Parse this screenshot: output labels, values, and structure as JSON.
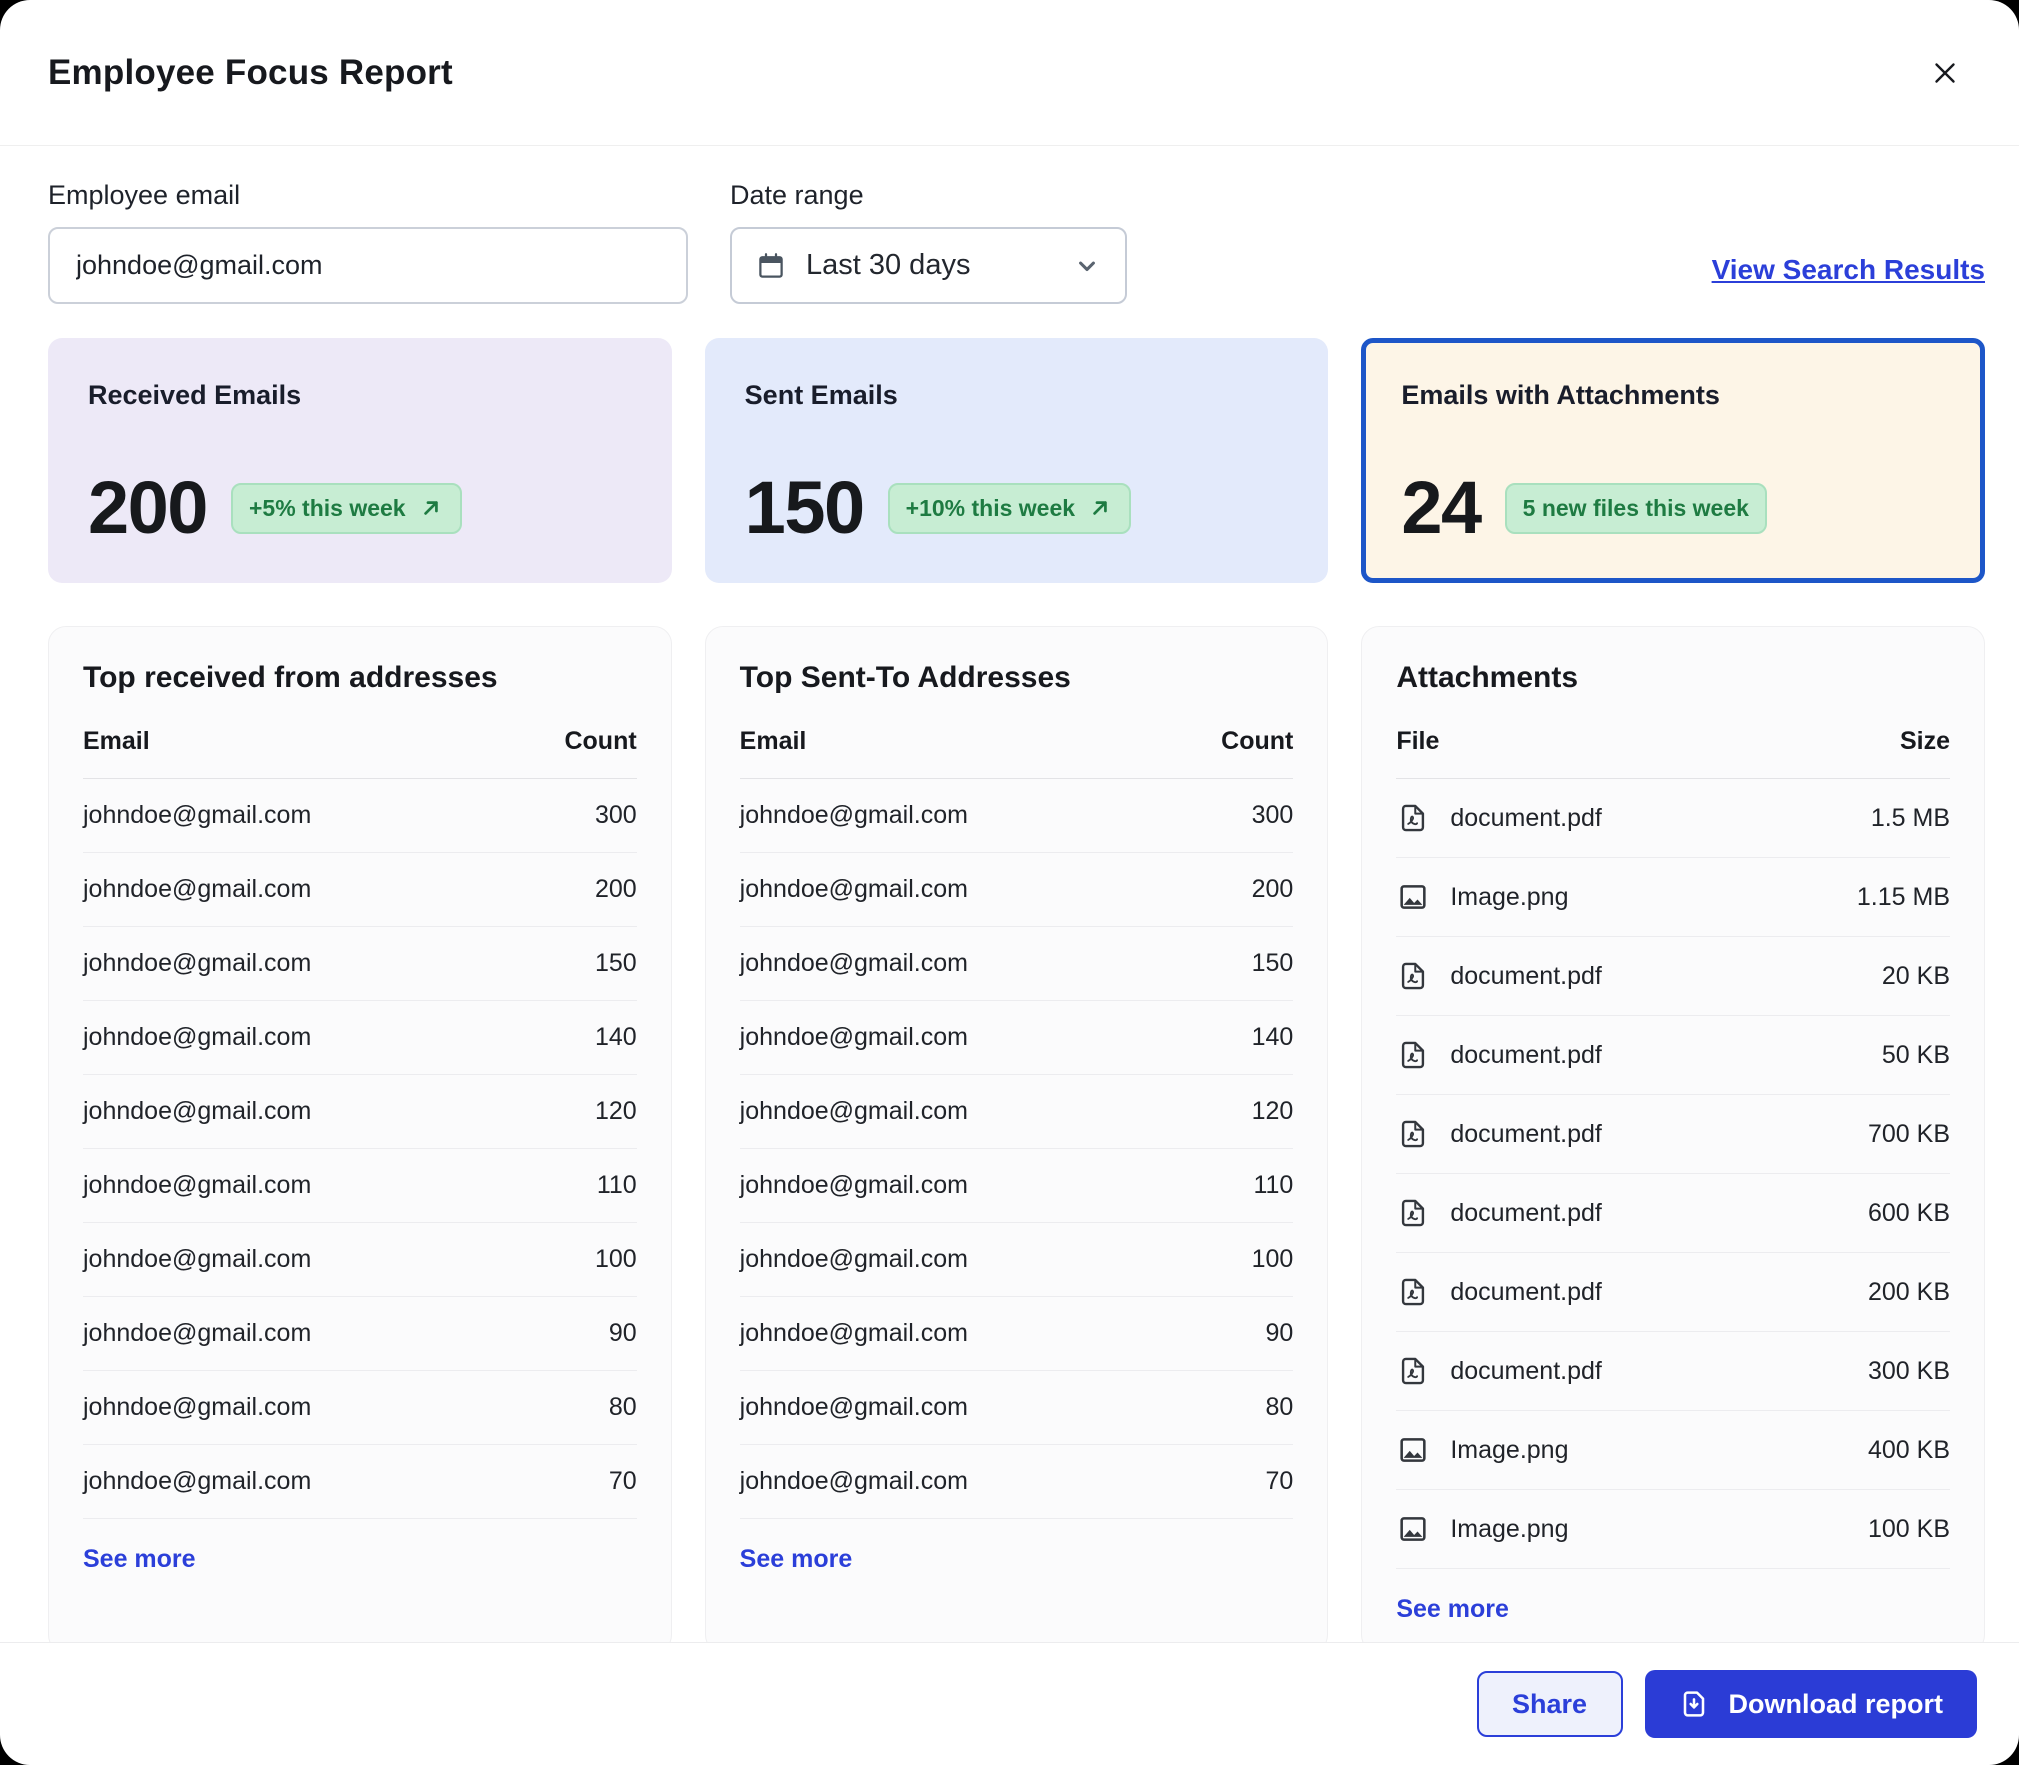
{
  "dialog": {
    "title": "Employee Focus Report"
  },
  "form": {
    "employee_email": {
      "label": "Employee email",
      "value": "johndoe@gmail.com"
    },
    "date_range": {
      "label": "Date range",
      "value": "Last 30 days"
    },
    "view_search_results": "View Search Results"
  },
  "stats": [
    {
      "title": "Received Emails",
      "value": "200",
      "badge": "+5% this week",
      "has_trend_arrow": true,
      "highlighted": false
    },
    {
      "title": "Sent Emails",
      "value": "150",
      "badge": "+10% this week",
      "has_trend_arrow": true,
      "highlighted": false
    },
    {
      "title": "Emails with Attachments",
      "value": "24",
      "badge": "5 new files this week",
      "has_trend_arrow": false,
      "highlighted": true
    }
  ],
  "tables": {
    "received": {
      "title": "Top received from addresses",
      "columns": [
        "Email",
        "Count"
      ],
      "rows": [
        {
          "email": "johndoe@gmail.com",
          "count": "300"
        },
        {
          "email": "johndoe@gmail.com",
          "count": "200"
        },
        {
          "email": "johndoe@gmail.com",
          "count": "150"
        },
        {
          "email": "johndoe@gmail.com",
          "count": "140"
        },
        {
          "email": "johndoe@gmail.com",
          "count": "120"
        },
        {
          "email": "johndoe@gmail.com",
          "count": "110"
        },
        {
          "email": "johndoe@gmail.com",
          "count": "100"
        },
        {
          "email": "johndoe@gmail.com",
          "count": "90"
        },
        {
          "email": "johndoe@gmail.com",
          "count": "80"
        },
        {
          "email": "johndoe@gmail.com",
          "count": "70"
        }
      ],
      "see_more": "See more"
    },
    "sent": {
      "title": "Top Sent-To Addresses",
      "columns": [
        "Email",
        "Count"
      ],
      "rows": [
        {
          "email": "johndoe@gmail.com",
          "count": "300"
        },
        {
          "email": "johndoe@gmail.com",
          "count": "200"
        },
        {
          "email": "johndoe@gmail.com",
          "count": "150"
        },
        {
          "email": "johndoe@gmail.com",
          "count": "140"
        },
        {
          "email": "johndoe@gmail.com",
          "count": "120"
        },
        {
          "email": "johndoe@gmail.com",
          "count": "110"
        },
        {
          "email": "johndoe@gmail.com",
          "count": "100"
        },
        {
          "email": "johndoe@gmail.com",
          "count": "90"
        },
        {
          "email": "johndoe@gmail.com",
          "count": "80"
        },
        {
          "email": "johndoe@gmail.com",
          "count": "70"
        }
      ],
      "see_more": "See more"
    },
    "attachments": {
      "title": "Attachments",
      "columns": [
        "File",
        "Size"
      ],
      "rows": [
        {
          "icon": "pdf-file-icon",
          "file": "document.pdf",
          "size": "1.5 MB"
        },
        {
          "icon": "image-icon",
          "file": "Image.png",
          "size": "1.15 MB"
        },
        {
          "icon": "pdf-file-icon",
          "file": "document.pdf",
          "size": "20 KB"
        },
        {
          "icon": "pdf-file-icon",
          "file": "document.pdf",
          "size": "50 KB"
        },
        {
          "icon": "pdf-file-icon",
          "file": "document.pdf",
          "size": "700 KB"
        },
        {
          "icon": "pdf-file-icon",
          "file": "document.pdf",
          "size": "600 KB"
        },
        {
          "icon": "pdf-file-icon",
          "file": "document.pdf",
          "size": "200 KB"
        },
        {
          "icon": "pdf-file-icon",
          "file": "document.pdf",
          "size": "300 KB"
        },
        {
          "icon": "image-icon",
          "file": "Image.png",
          "size": "400 KB"
        },
        {
          "icon": "image-icon",
          "file": "Image.png",
          "size": "100 KB"
        }
      ],
      "see_more": "See more"
    }
  },
  "footer": {
    "share_label": "Share",
    "download_label": "Download report"
  },
  "icons": {
    "close-icon": "✕",
    "calendar-icon": "calendar glyph (svg)",
    "chevron-down-icon": "⌄",
    "trend-up-arrow-icon": "↗",
    "pdf-file-icon": "file with pdf curl (svg)",
    "image-icon": "framed picture (svg)",
    "download-file-icon": "file with down arrow (svg)"
  },
  "colors": {
    "accent_blue": "#2B3FD9",
    "download_button_blue": "#2B3CD6",
    "highlight_border_blue": "#1D56C8",
    "badge_green_bg": "#C7EDD3",
    "badge_green_text": "#1E7B42",
    "card_received_bg": "#EDE9F7",
    "card_sent_bg": "#E3EAFB",
    "card_attachments_bg": "#FDF5E7"
  }
}
